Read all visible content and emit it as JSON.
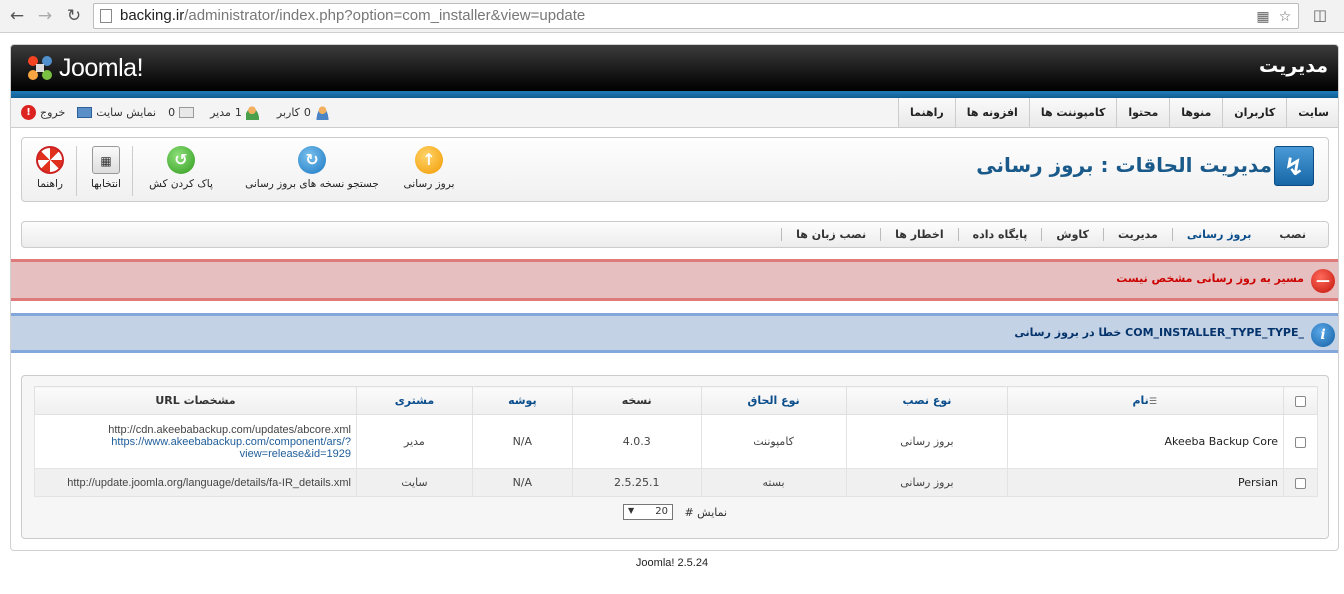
{
  "browser": {
    "url_host": "backing.ir",
    "url_path": "/administrator/index.php?option=com_installer&view=update"
  },
  "header": {
    "logo_text": "Joomla!",
    "title": "مدیریت"
  },
  "topmenu": {
    "items": [
      "سایت",
      "کاربران",
      "منوها",
      "محتوا",
      "کامپوننت ها",
      "افزونه ها",
      "راهنما"
    ]
  },
  "status": {
    "users_count": "0",
    "users_label": "کاربر",
    "admins_count": "1",
    "admins_label": "مدیر",
    "messages_count": "0",
    "view_site_label": "نمایش سایت",
    "logout_label": "خروج"
  },
  "toolbar": {
    "page_title": "مدیریت الحاقات : بروز رسانی",
    "update_label": "بروز رسانی",
    "find_updates_label": "جستجو نسخه های بروز رسانی",
    "purge_cache_label": "پاک کردن کش",
    "options_label": "انتخابها",
    "help_label": "راهنما"
  },
  "submenu": {
    "items": [
      "نصب",
      "بروز رسانی",
      "مدیریت",
      "کاوش",
      "پایگاه داده",
      "اخطار ها",
      "نصب زبان ها"
    ],
    "active_index": 1
  },
  "messages": {
    "error": "مسیر به روز رسانی مشخص نیست",
    "notice": "خطا در بروز رسانی COM_INSTALLER_TYPE_TYPE_"
  },
  "table": {
    "headers": {
      "name": "نام",
      "install_type": "نوع نصب",
      "extension_type": "نوع الحاق",
      "version": "نسخه",
      "folder": "پوشه",
      "client": "مشتری",
      "url": "مشخصات URL"
    },
    "rows": [
      {
        "name": "Akeeba Backup Core",
        "install_type": "بروز رسانی",
        "extension_type": "کامپوننت",
        "version": "4.0.3",
        "folder": "N/A",
        "client": "مدیر",
        "url_line1": "http://cdn.akeebabackup.com/updates/abcore.xml",
        "url_line2": "https://www.akeebabackup.com/component/ars/?",
        "url_line3": "view=release&id=1929"
      },
      {
        "name": "Persian",
        "install_type": "بروز رسانی",
        "extension_type": "بسته",
        "version": "2.5.25.1",
        "folder": "N/A",
        "client": "سایت",
        "url_line1": "http://update.joomla.org/language/details/fa-IR_details.xml"
      }
    ],
    "limit_label": "نمایش #",
    "limit_value": "20"
  },
  "footer": {
    "version": "Joomla! 2.5.24"
  }
}
